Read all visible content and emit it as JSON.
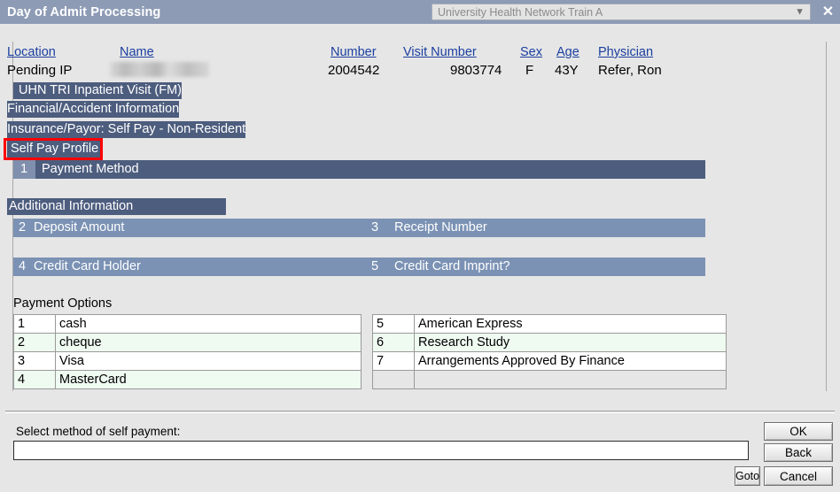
{
  "titlebar": {
    "title": "Day of Admit Processing",
    "environment": "University Health Network Train A",
    "chevron_icon": "chevron-down-icon",
    "close_icon": "close-icon"
  },
  "patient_header": {
    "labels": {
      "location": "Location",
      "name": "Name",
      "number": "Number",
      "visit_number": "Visit Number",
      "sex": "Sex",
      "age": "Age",
      "physician": "Physician"
    },
    "values": {
      "location": "Pending IP",
      "name": "",
      "number": "2004542",
      "visit_number": "9803774",
      "sex": "F",
      "age": "43Y",
      "physician": "Refer, Ron"
    }
  },
  "context_bands": {
    "visit": "UHN TRI Inpatient Visit (FM)",
    "financial": "Financial/Accident Information",
    "insurance": "Insurance/Payor:  Self Pay - Non-Resident",
    "self_pay_profile": "Self Pay Profile",
    "additional_information": "Additional Information"
  },
  "fields": [
    {
      "num": "1",
      "label": "Payment Method",
      "value": ""
    },
    {
      "num": "2",
      "label": "Deposit Amount",
      "value": ""
    },
    {
      "num": "3",
      "label": "Receipt Number",
      "value": ""
    },
    {
      "num": "4",
      "label": "Credit Card Holder",
      "value": ""
    },
    {
      "num": "5",
      "label": "Credit Card Imprint?",
      "value": ""
    }
  ],
  "payment_options": {
    "title": "Payment Options",
    "left": [
      {
        "idx": "1",
        "label": "cash"
      },
      {
        "idx": "2",
        "label": "cheque"
      },
      {
        "idx": "3",
        "label": "Visa"
      },
      {
        "idx": "4",
        "label": "MasterCard"
      }
    ],
    "right": [
      {
        "idx": "5",
        "label": "American Express"
      },
      {
        "idx": "6",
        "label": "Research Study"
      },
      {
        "idx": "7",
        "label": "Arrangements Approved By Finance"
      },
      {
        "idx": "",
        "label": ""
      }
    ]
  },
  "bottom": {
    "prompt": "Select method of self payment:",
    "answer_value": "",
    "answer_placeholder": "",
    "buttons": {
      "ok": "OK",
      "back": "Back",
      "cancel": "Cancel",
      "goto": "Goto"
    }
  },
  "colors": {
    "titlebar": "#8d9bb5",
    "band_dark": "#4d5d7e",
    "band_light": "#7b92b4",
    "highlight_red": "#ff0000",
    "link_blue": "#1b3fa0",
    "row_alt": "#effaf1",
    "page_bg": "#e6e6e6"
  }
}
